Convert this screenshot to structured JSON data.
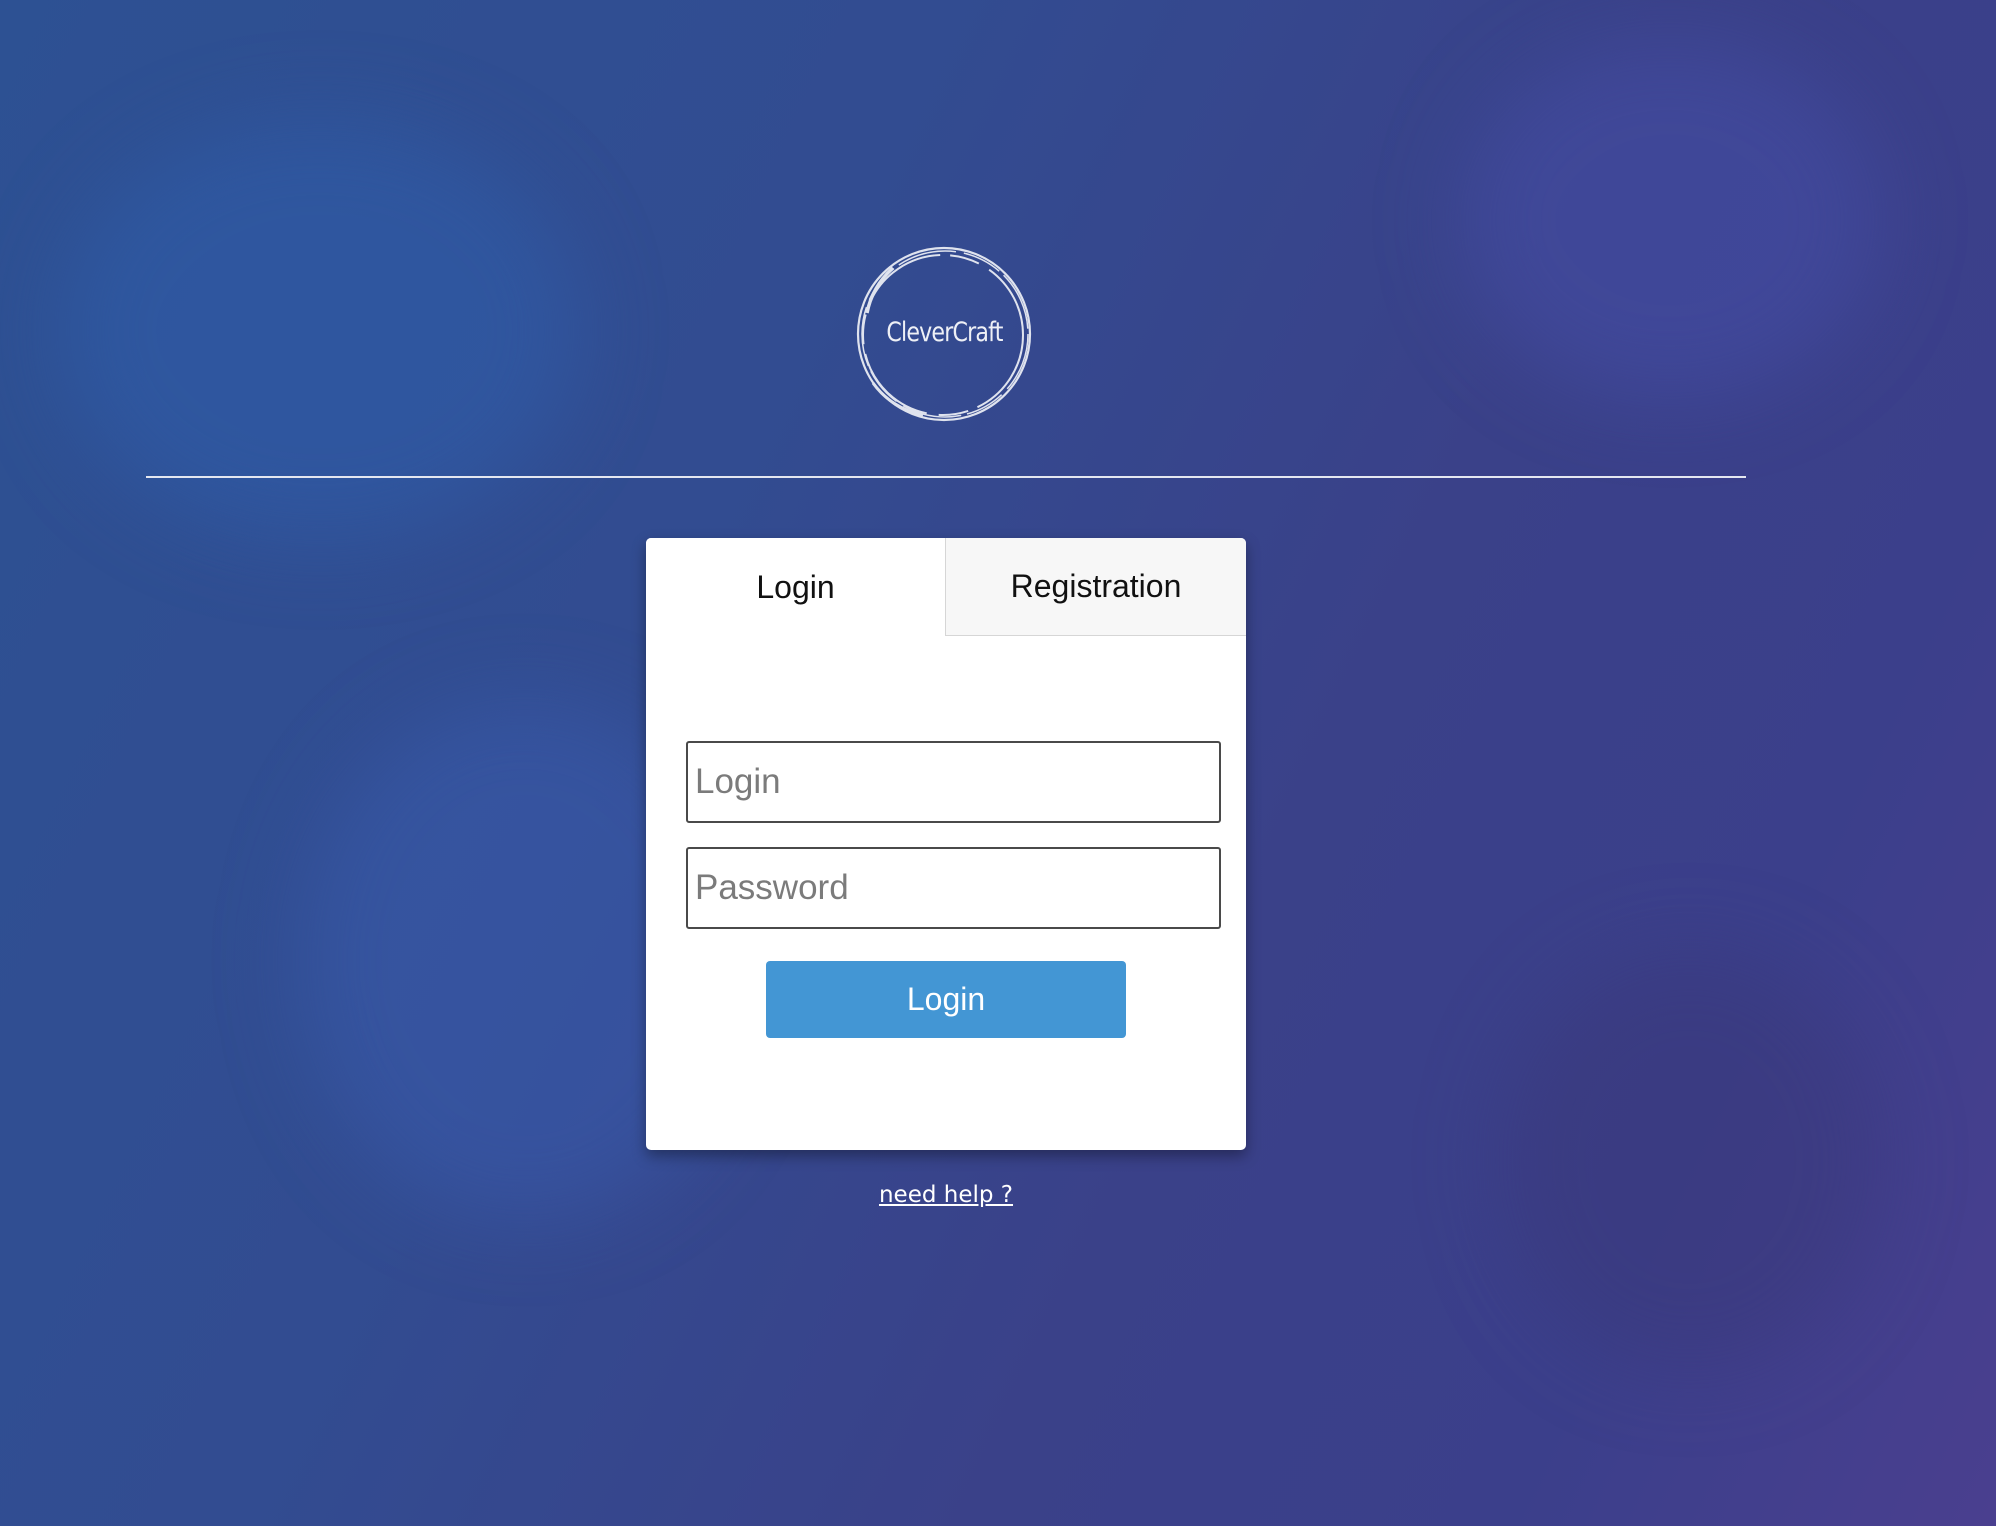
{
  "brand": {
    "name": "CleverCraft"
  },
  "tabs": [
    {
      "label": "Login",
      "active": true
    },
    {
      "label": "Registration",
      "active": false
    }
  ],
  "form": {
    "login_placeholder": "Login",
    "login_value": "",
    "password_placeholder": "Password",
    "password_value": "",
    "submit_label": "Login"
  },
  "help_link": "need help ?",
  "colors": {
    "button": "#4396d4",
    "background": "#324c91",
    "card": "#ffffff"
  }
}
